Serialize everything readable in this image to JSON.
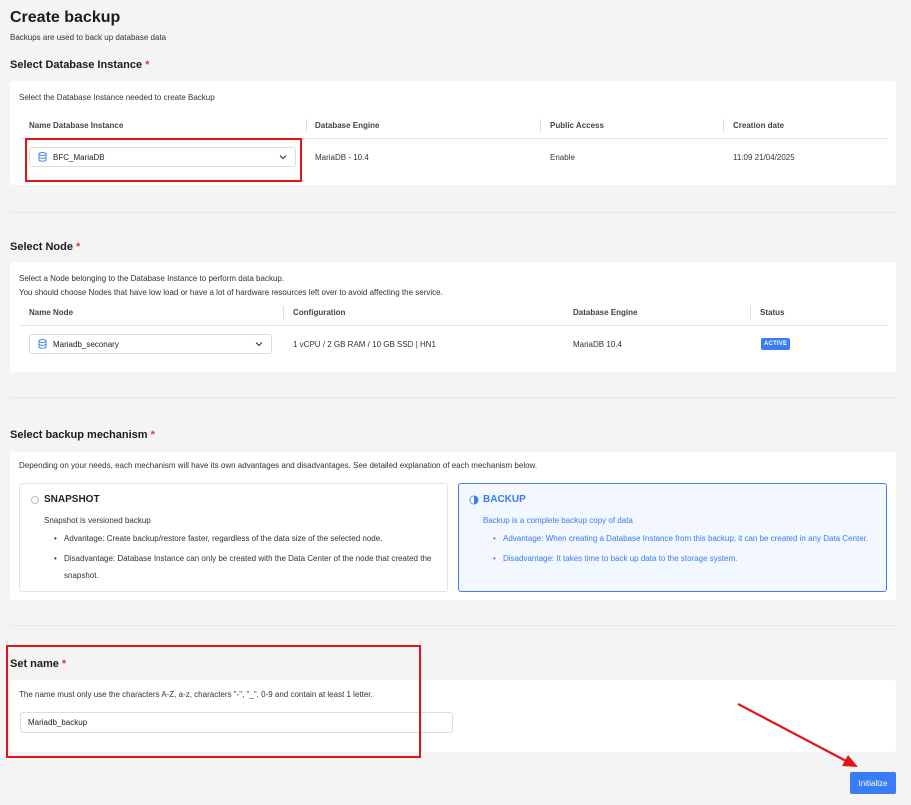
{
  "page": {
    "title": "Create backup",
    "subtitle": "Backups are used to back up database data"
  },
  "required_mark": "*",
  "db_instance": {
    "title": "Select Database Instance",
    "description": "Select the Database Instance needed to create Backup",
    "headers": [
      "Name Database Instance",
      "Database Engine",
      "Public Access",
      "Creation date"
    ],
    "selected": "BFC_MariaDB",
    "engine": "MariaDB - 10.4",
    "public_access": "Enable",
    "creation_date": "11:09 21/04/2025"
  },
  "node": {
    "title": "Select Node",
    "description_lines": [
      "Select a Node belonging to the Database Instance to perform data backup.",
      "You should choose Nodes that have low load or have a lot of hardware resources left over to avoid affecting the service."
    ],
    "headers": [
      "Name Node",
      "Configuration",
      "Database Engine",
      "Status"
    ],
    "selected": "Mariadb_seconary",
    "configuration": "1 vCPU / 2 GB RAM / 10 GB SSD | HN1",
    "engine": "MariaDB 10.4",
    "status": "ACTIVE"
  },
  "mechanism": {
    "title": "Select backup mechanism",
    "description": "Depending on your needs, each mechanism will have its own advantages and disadvantages. See detailed explanation of each mechanism below.",
    "options": [
      {
        "title": "SNAPSHOT",
        "subtitle": "Snapshot is versioned backup",
        "points": [
          "Advantage: Create backup/restore faster, regardless of the data size of the selected node.",
          "Disadvantage: Database Instance can only be created with the Data Center of the node that created the snapshot."
        ],
        "selected": false
      },
      {
        "title": "BACKUP",
        "subtitle": "Backup is a complete backup copy of data",
        "points": [
          "Advantage: When creating a Database Instance from this backup, it can be created in any Data Center.",
          "Disadvantage: It takes time to back up data to the storage system."
        ],
        "selected": true
      }
    ]
  },
  "set_name": {
    "title": "Set name",
    "description": "The name must only use the characters A-Z, a-z, characters \"-\", \"_\", 0-9 and contain at least 1 letter.",
    "value": "Mariadb_backup"
  },
  "actions": {
    "initialize_label": "Initialize"
  },
  "colors": {
    "accent": "#3a7bf6",
    "required": "#e53935",
    "highlight": "#e2141a"
  }
}
